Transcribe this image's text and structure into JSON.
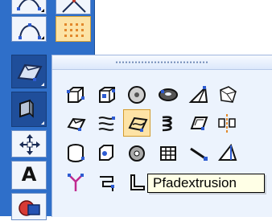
{
  "toolbar": {
    "buttons": [
      {
        "icon": "curve-icon"
      },
      {
        "icon": "angle-icon"
      },
      {
        "icon": "arc-icon"
      },
      {
        "icon": "point-grid-icon"
      },
      {
        "icon": "solids-flyout-icon"
      },
      {
        "icon": "surface-icon"
      },
      {
        "icon": "move-icon"
      },
      {
        "icon": "text-icon",
        "label": "A"
      },
      {
        "icon": "render-icon"
      }
    ]
  },
  "flyout": {
    "tools": [
      [
        "box-icon",
        "box-edit-icon",
        "sphere-icon",
        "torus-icon",
        "pyramid-icon",
        "solid-wire-icon"
      ],
      [
        "extrude-icon",
        "loft-icon",
        "path-extrusion-icon",
        "helix-icon",
        "shell-icon",
        "mirror-solid-icon"
      ],
      [
        "cylinder-icon",
        "cone-icon",
        "ring-icon",
        "grid-solid-icon",
        "knife-icon",
        "wedge-icon"
      ],
      [
        "branch-icon",
        "sweep-icon",
        "slice-icon",
        "plane-icon",
        "flat-plate-icon",
        "hollow-cylinder-icon"
      ]
    ],
    "selected_tool": "path-extrusion-icon"
  },
  "tooltip": {
    "text": "Pfadextrusion"
  },
  "colors": {
    "toolbar": "#2f6fc9",
    "panel": "#ecf3fd",
    "selected": "#fde3a6",
    "tooltip_bg": "#ffffe6"
  }
}
